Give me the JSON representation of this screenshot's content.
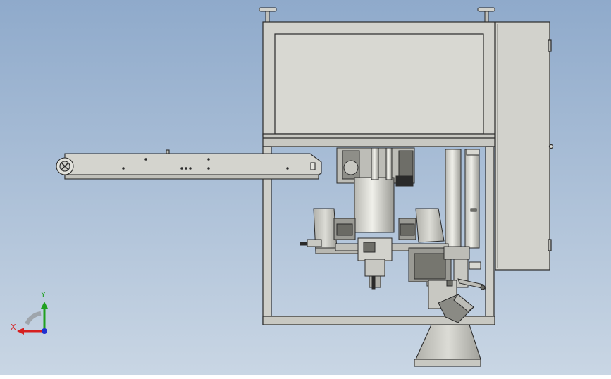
{
  "viewport": {
    "background_top": "#8faacb",
    "background_bottom": "#c9d6e4"
  },
  "colors": {
    "metal": "#d2d2cc",
    "metal_light": "#e6e6e0",
    "metal_dark": "#a8a8a2",
    "outline": "#2a2a2a",
    "shadow": "#5a5a55",
    "axis_x": "#d62020",
    "axis_y": "#20a020",
    "axis_z": "#2030d0"
  },
  "triad": {
    "x_label": "X",
    "y_label": "Y"
  }
}
